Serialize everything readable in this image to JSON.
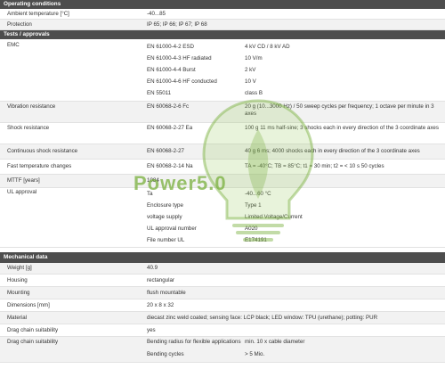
{
  "operating": {
    "heading": "Operating conditions",
    "rows": [
      {
        "label": "Ambient temperature [°C]",
        "value": "-40...85"
      },
      {
        "label": "Protection",
        "value": "IP 65; IP 66; IP 67; IP 68"
      }
    ]
  },
  "tests": {
    "heading": "Tests / approvals",
    "emc_label": "EMC",
    "emc": [
      {
        "std": "EN 61000-4-2 ESD",
        "value": "4 kV CD / 8 kV AD"
      },
      {
        "std": "EN 61000-4-3 HF radiated",
        "value": "10 V/m"
      },
      {
        "std": "EN 61000-4-4 Burst",
        "value": "2 kV"
      },
      {
        "std": "EN 61000-4-6 HF conducted",
        "value": "10 V"
      },
      {
        "std": "EN 55011",
        "value": "class B"
      }
    ],
    "vibration_label": "Vibration resistance",
    "vibration_std": "EN 60068-2-6 Fc",
    "vibration_value": "20 g (10...3000 Hz) / 50 sweep cycles per frequency; 1 octave per minute in 3 axes",
    "shock_label": "Shock resistance",
    "shock_std": "EN 60068-2-27 Ea",
    "shock_value": "100 g 11 ms half-sine; 3 shocks each in every direction of the 3 coordinate axes",
    "cont_label": "Continuous shock resistance",
    "cont_std": "EN 60068-2-27",
    "cont_value": "40 g 6 ms; 4000 shocks each in every direction of the 3 coordinate axes",
    "fast_label": "Fast temperature changes",
    "fast_std": "EN 60068-2-14 Na",
    "fast_value": "TA = -40°C; TB = 85°C; t1 = 30 min; t2 = < 10 s 50 cycles",
    "mttf_label": "MTTF [years]",
    "mttf_value": "1084",
    "ul_label": "UL approval",
    "ul": [
      {
        "k": "Ta",
        "v": "-40...60 °C"
      },
      {
        "k": "Enclosure type",
        "v": "Type 1"
      },
      {
        "k": "voltage supply",
        "v": "Limited Voltage/Current"
      },
      {
        "k": "UL approval number",
        "v": "A020"
      },
      {
        "k": "File number UL",
        "v": "E174191"
      }
    ]
  },
  "mechanical": {
    "heading": "Mechanical data",
    "rows": [
      {
        "label": "Weight [g]",
        "value": "40.9"
      },
      {
        "label": "Housing",
        "value": "rectangular"
      },
      {
        "label": "Mounting",
        "value": "flush mountable"
      },
      {
        "label": "Dimensions [mm]",
        "value": "20 x 8 x 32"
      },
      {
        "label": "Material",
        "value": "diecast zinc weld coated; sensing face: LCP black; LED window: TPU (urethane); potting: PUR"
      },
      {
        "label": "Drag chain suitability",
        "value": "yes"
      }
    ],
    "drag_label": "Drag chain suitability",
    "drag": [
      {
        "k": "Bending radius for flexible applications",
        "v": "min. 10 x cable diameter"
      },
      {
        "k": "Bending cycles",
        "v": "> 5 Mio."
      }
    ]
  },
  "watermark": {
    "text": "Power5.0"
  }
}
